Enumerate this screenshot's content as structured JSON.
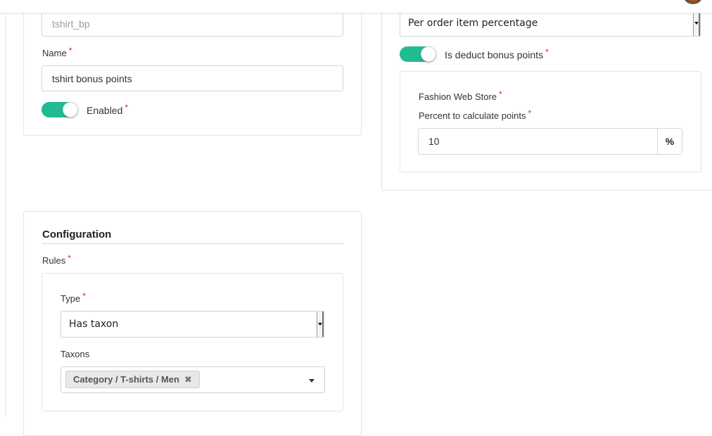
{
  "header": {
    "avatar_icon": "user-avatar"
  },
  "general": {
    "code_value": "tshirt_bp",
    "name_label": "Name",
    "name_value": "tshirt bonus points",
    "enabled_label": "Enabled",
    "enabled_on": true
  },
  "calculation": {
    "type_value": "Per order item percentage",
    "deduct_label": "Is deduct bonus points",
    "deduct_on": true,
    "channel_label": "Fashion Web Store",
    "percent_label": "Percent to calculate points",
    "percent_value": "10",
    "percent_unit": "%"
  },
  "configuration": {
    "title": "Configuration",
    "rules_label": "Rules",
    "type_label": "Type",
    "type_value": "Has taxon",
    "taxons_label": "Taxons",
    "taxon_chips": [
      {
        "label": "Category / T-shirts / Men",
        "remove_symbol": "✖"
      }
    ]
  },
  "required_marker": "*",
  "colors": {
    "toggle_on": "#21ba93",
    "required": "#db2828",
    "border": "#d4d4d5"
  }
}
